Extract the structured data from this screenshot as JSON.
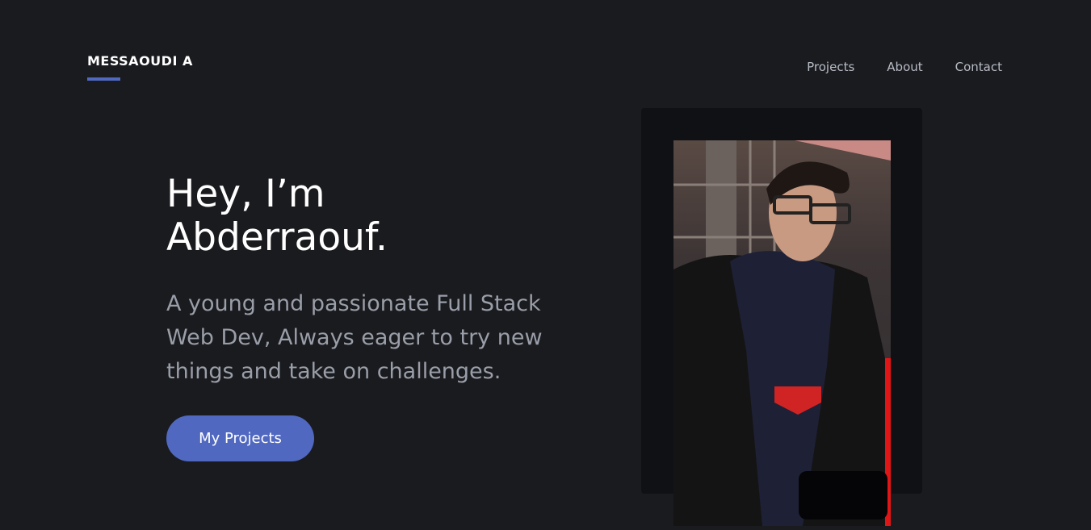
{
  "header": {
    "logo": "MESSAOUDI A",
    "nav": [
      {
        "label": "Projects"
      },
      {
        "label": "About"
      },
      {
        "label": "Contact"
      }
    ]
  },
  "hero": {
    "title": "Hey, I’m Abderraouf.",
    "subtitle": "A young and passionate Full Stack Web Dev, Always eager to try new things and take on challenges.",
    "cta_label": "My Projects"
  },
  "colors": {
    "accent": "#5068c0",
    "background": "#1a1b1f",
    "panel": "#101115"
  }
}
